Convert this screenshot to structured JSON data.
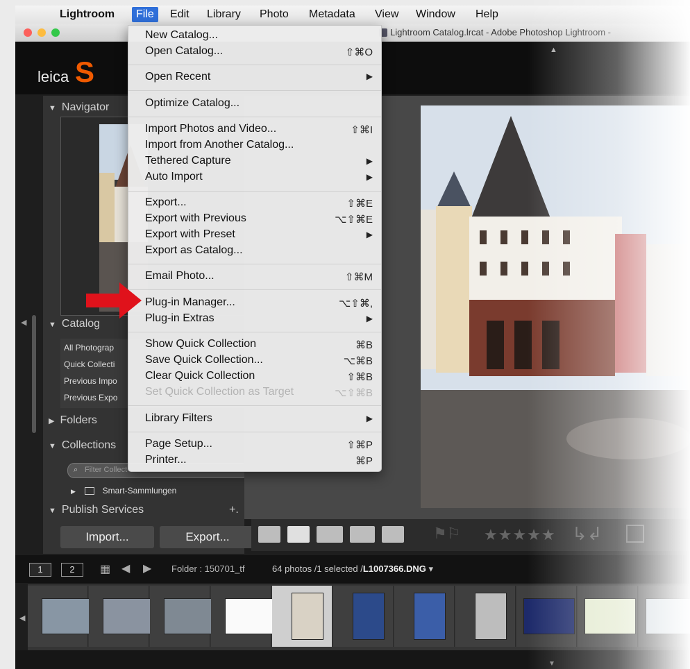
{
  "menubar": {
    "app": "Lightroom",
    "items": [
      "File",
      "Edit",
      "Library",
      "Photo",
      "Metadata",
      "View",
      "Window",
      "Help"
    ]
  },
  "window": {
    "title": "Lightroom Catalog.lrcat - Adobe Photoshop Lightroom -",
    "logo_text": "leica",
    "logo_letter": "S"
  },
  "left_panel": {
    "navigator": "Navigator",
    "catalog": "Catalog",
    "catalog_items": [
      "All Photograp",
      "Quick Collecti",
      "Previous Impo",
      "Previous Expo"
    ],
    "folders": "Folders",
    "collections": "Collections",
    "filter_placeholder": "Filter Collect",
    "smart_collection": "Smart-Sammlungen",
    "publish_services": "Publish Services",
    "publish_add": "+.",
    "import_button": "Import...",
    "export_button": "Export..."
  },
  "file_menu": {
    "items": [
      {
        "label": "New Catalog...",
        "shortcut": ""
      },
      {
        "label": "Open Catalog...",
        "shortcut": "⇧⌘O"
      },
      {
        "label": "Open Recent",
        "shortcut": "▶"
      },
      {
        "label": "Optimize Catalog...",
        "shortcut": ""
      },
      {
        "label": "Import Photos and Video...",
        "shortcut": "⇧⌘I"
      },
      {
        "label": "Import from Another Catalog...",
        "shortcut": ""
      },
      {
        "label": "Tethered Capture",
        "shortcut": "▶"
      },
      {
        "label": "Auto Import",
        "shortcut": "▶"
      },
      {
        "label": "Export...",
        "shortcut": "⇧⌘E"
      },
      {
        "label": "Export with Previous",
        "shortcut": "⌥⇧⌘E"
      },
      {
        "label": "Export with Preset",
        "shortcut": "▶"
      },
      {
        "label": "Export as Catalog...",
        "shortcut": ""
      },
      {
        "label": "Email Photo...",
        "shortcut": "⇧⌘M"
      },
      {
        "label": "Plug-in Manager...",
        "shortcut": "⌥⇧⌘,"
      },
      {
        "label": "Plug-in Extras",
        "shortcut": "▶"
      },
      {
        "label": "Show Quick Collection",
        "shortcut": "⌘B"
      },
      {
        "label": "Save Quick Collection...",
        "shortcut": "⌥⌘B"
      },
      {
        "label": "Clear Quick Collection",
        "shortcut": "⇧⌘B"
      },
      {
        "label": "Set Quick Collection as Target",
        "shortcut": "⌥⇧⌘B",
        "disabled": true
      },
      {
        "label": "Library Filters",
        "shortcut": "▶"
      },
      {
        "label": "Page Setup...",
        "shortcut": "⇧⌘P"
      },
      {
        "label": "Printer...",
        "shortcut": "⌘P"
      }
    ]
  },
  "filmstrip": {
    "page1": "1",
    "page2": "2",
    "folder": "Folder : 150701_tf",
    "count": "64 photos /1 selected /",
    "filename": "L1007366.DNG",
    "dropdown": "▾"
  },
  "toolbar": {
    "stars": "★★★★★"
  },
  "colors": {
    "accent_menu": "#2f6fd9",
    "logo_orange": "#f05a00",
    "arrow_red": "#e0121b"
  }
}
